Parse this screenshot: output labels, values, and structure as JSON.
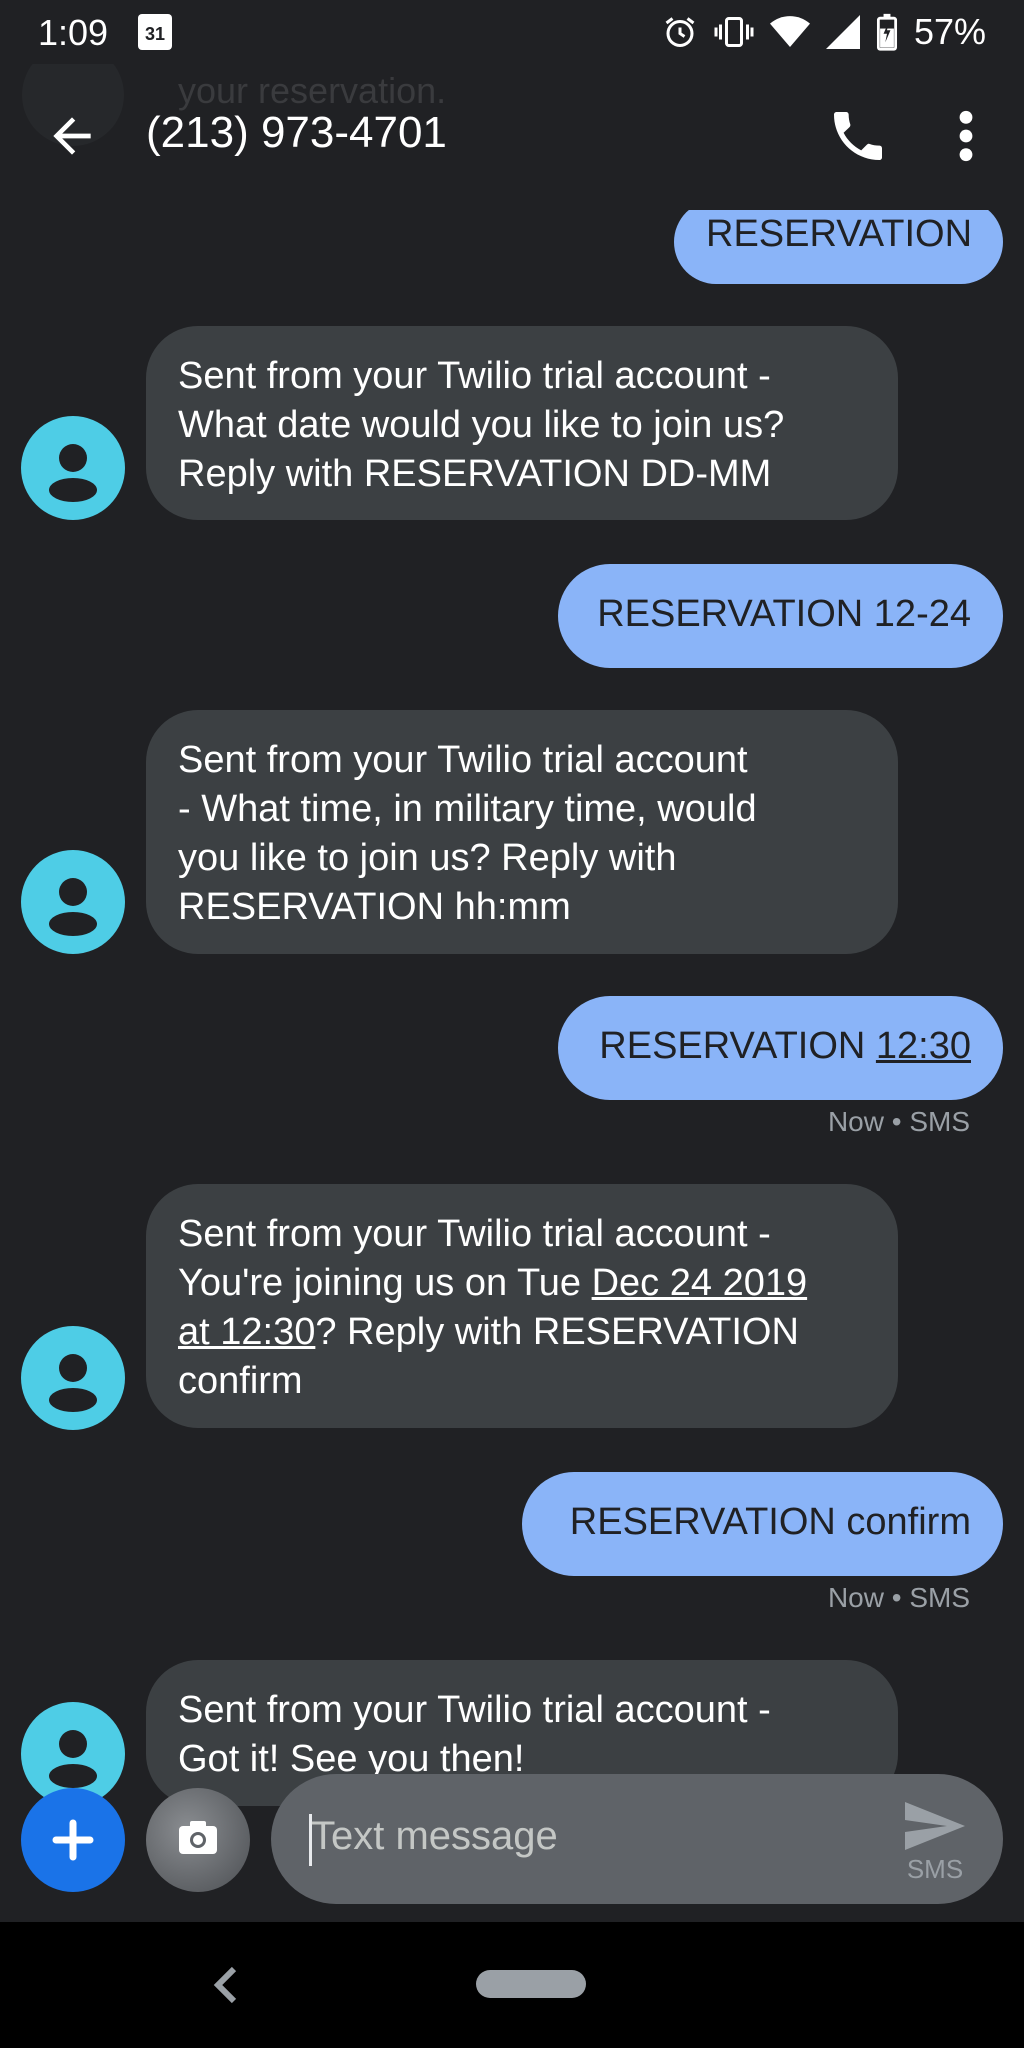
{
  "status_bar": {
    "time": "1:09",
    "calendar_day": "31",
    "battery_percent": "57%"
  },
  "app_bar": {
    "ghost_text": "your reservation.",
    "title": "(213) 973-4701"
  },
  "messages": [
    {
      "direction": "out",
      "text": "RESERVATION"
    },
    {
      "direction": "in",
      "lines": [
        "Sent from your Twilio trial account -",
        "What date would you like to join us?",
        "Reply with RESERVATION DD-MM"
      ]
    },
    {
      "direction": "out",
      "text": "RESERVATION 12-24"
    },
    {
      "direction": "in",
      "lines": [
        "Sent from your Twilio trial account",
        "- What time, in military time, would",
        "you like to join us? Reply with",
        "RESERVATION hh:mm"
      ]
    },
    {
      "direction": "out",
      "text_prefix": "RESERVATION ",
      "text_link": "12:30",
      "meta": "Now • SMS"
    },
    {
      "direction": "in",
      "line1": "Sent from your Twilio trial account -",
      "line2_prefix": "You're joining us on Tue ",
      "line2_link": "Dec 24 2019",
      "line3_link": "at 12:30",
      "line3_suffix": "? Reply with RESERVATION",
      "line4": "confirm"
    },
    {
      "direction": "out",
      "text": "RESERVATION confirm",
      "meta": "Now • SMS"
    },
    {
      "direction": "in",
      "lines": [
        "Sent from your Twilio trial account -",
        "Got it! See you then!"
      ]
    }
  ],
  "compose": {
    "placeholder": "Text message",
    "send_label": "SMS"
  },
  "colors": {
    "background": "#202124",
    "incoming_bubble": "#3c4043",
    "outgoing_bubble": "#8ab4f8",
    "avatar": "#4ecde6",
    "fab": "#1a73e8"
  }
}
